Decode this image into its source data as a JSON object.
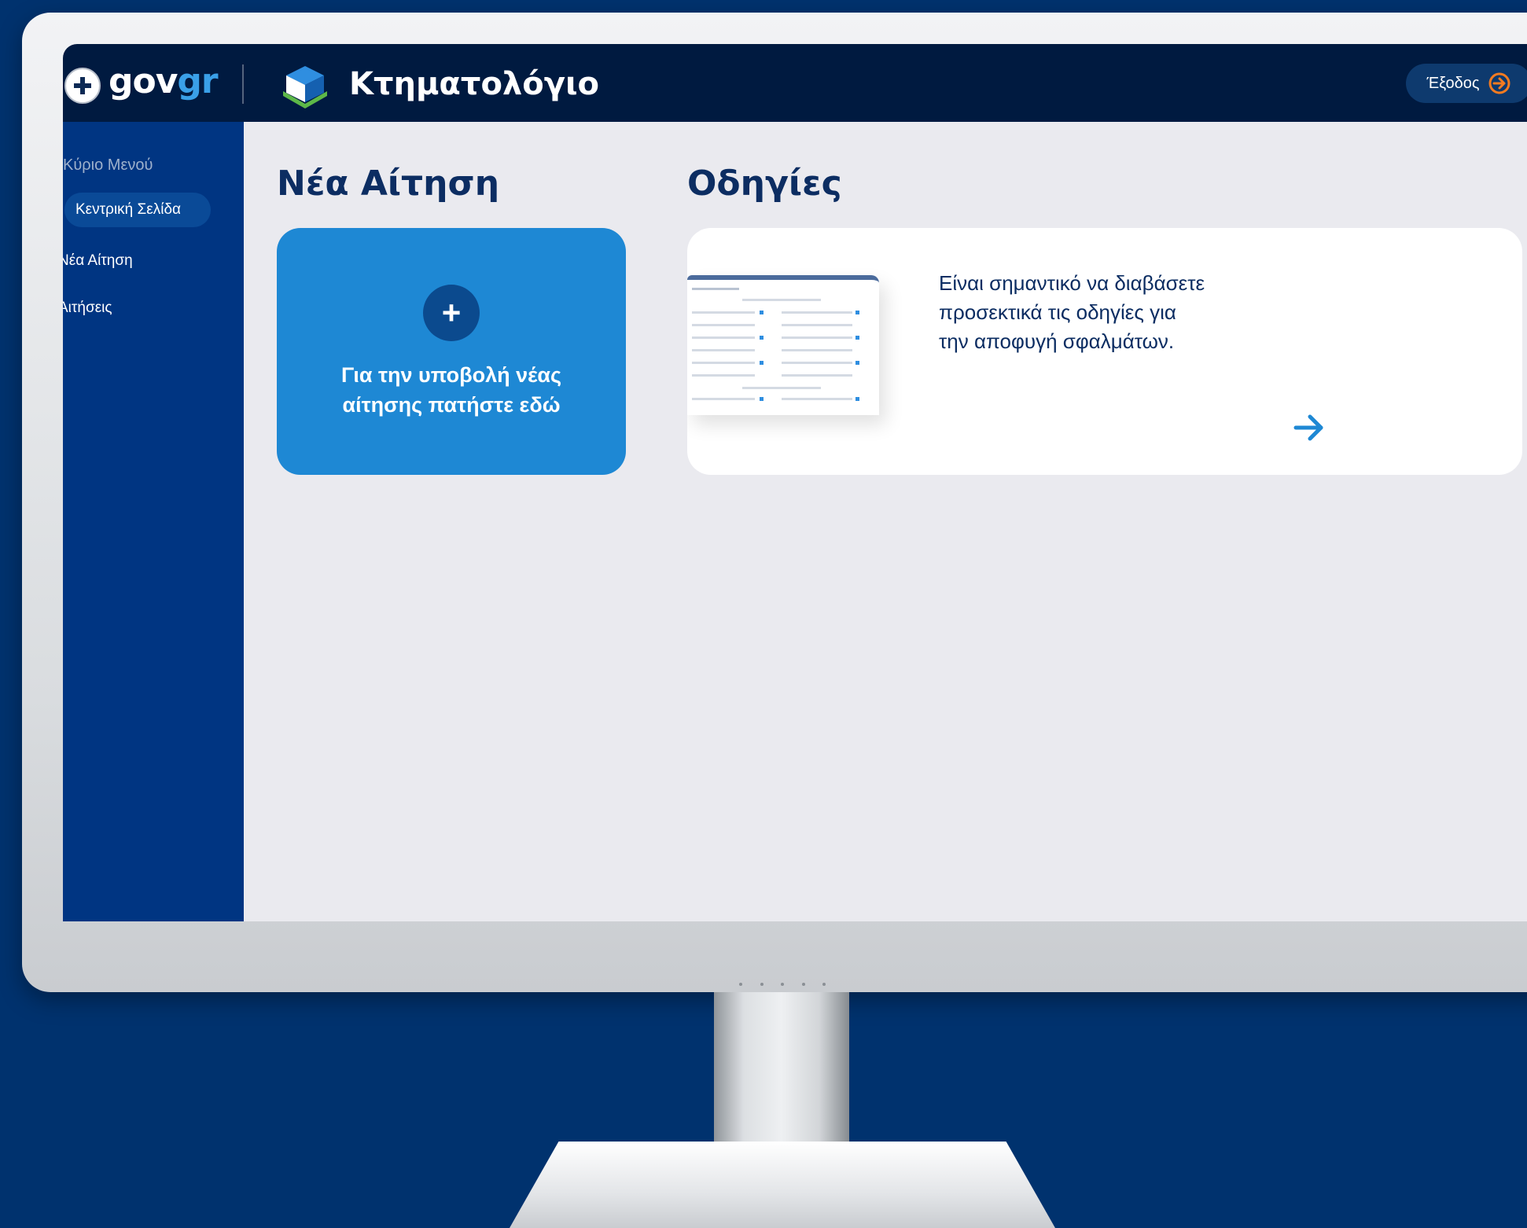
{
  "header": {
    "brand_gov": "gov",
    "brand_gr": "gr",
    "app_title": "Κτηματολόγιο",
    "logout_label": "Έξοδος"
  },
  "sidebar": {
    "heading": "Κύριο Μενού",
    "items": [
      {
        "label": "Κεντρική Σελίδα",
        "active": true
      },
      {
        "label": "Νέα Αίτηση",
        "active": false
      },
      {
        "label": "Αιτήσεις",
        "active": false
      }
    ]
  },
  "main": {
    "new_request": {
      "title": "Νέα Αίτηση",
      "card_text_line1": "Για την υποβολή νέας",
      "card_text_line2": "αίτησης πατήστε εδώ"
    },
    "guides": {
      "title": "Οδηγίες",
      "text_line1": "Είναι σημαντικό να διαβάσετε",
      "text_line2": "προσεκτικά τις οδηγίες για",
      "text_line3": "την αποφυγή σφαλμάτων."
    }
  },
  "colors": {
    "background": "#00326e",
    "header": "#001a40",
    "sidebar": "#003582",
    "primary_card": "#1e88d4",
    "accent_orange": "#f47b20",
    "title_navy": "#0c2d62"
  },
  "icons": [
    "hellenic-emblem-icon",
    "ktimatologio-logo-icon",
    "logout-arrow-icon",
    "plus-icon",
    "arrow-right-icon"
  ]
}
